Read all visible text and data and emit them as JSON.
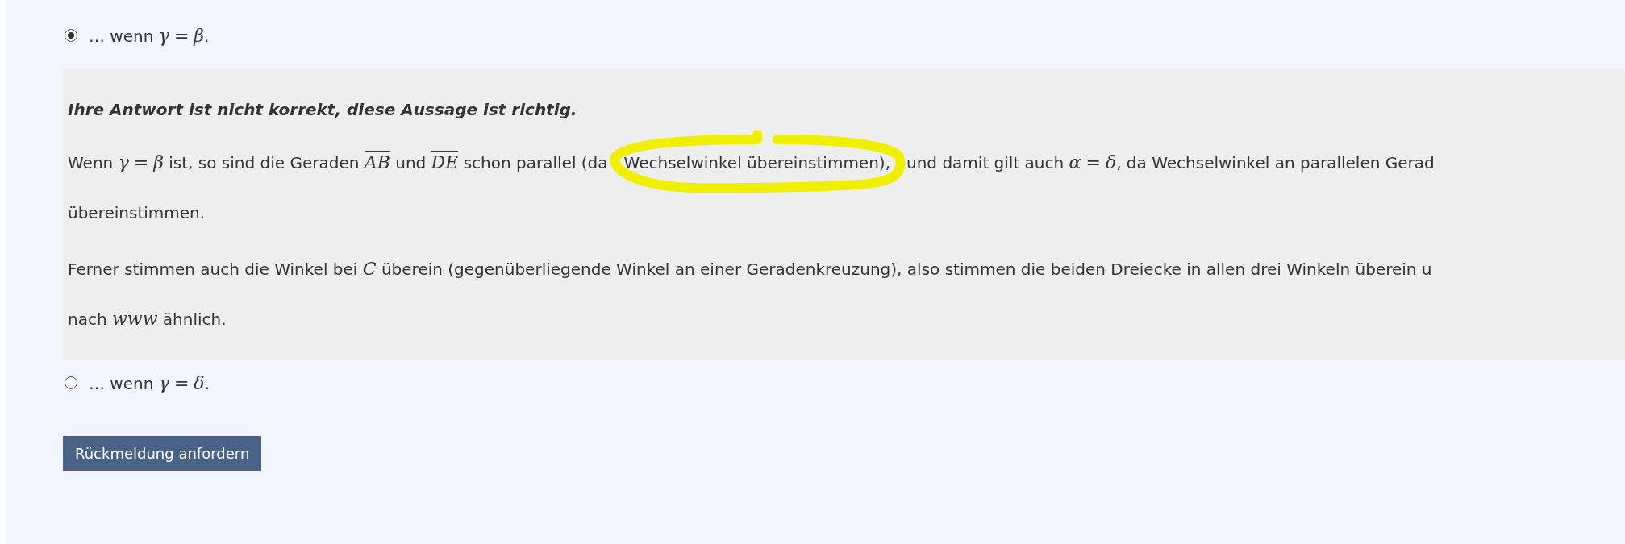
{
  "options": [
    {
      "selected": true,
      "label": [
        {
          "kind": "text",
          "text": "… wenn "
        },
        {
          "kind": "math",
          "text": "γ"
        },
        {
          "kind": "op",
          "text": "="
        },
        {
          "kind": "math",
          "text": "β"
        },
        {
          "kind": "text",
          "text": "."
        }
      ],
      "feedback": {
        "verdict": "Ihre Antwort ist nicht korrekt, diese Aussage ist richtig.",
        "paragraphs": [
          [
            [
              {
                "kind": "text",
                "text": "Wenn "
              },
              {
                "kind": "math",
                "text": "γ"
              },
              {
                "kind": "op",
                "text": "="
              },
              {
                "kind": "math",
                "text": "β"
              },
              {
                "kind": "text",
                "text": " ist, so sind die Geraden "
              },
              {
                "kind": "segment",
                "text": "AB"
              },
              {
                "kind": "text",
                "text": " und "
              },
              {
                "kind": "segment",
                "text": "DE"
              },
              {
                "kind": "text",
                "text": " schon parallel (da"
              },
              {
                "kind": "text",
                "text": "Wechselwinkel übereinstimmen),",
                "circled": true
              },
              {
                "kind": "text",
                "text": "und damit gilt auch "
              },
              {
                "kind": "math",
                "text": "α"
              },
              {
                "kind": "op",
                "text": "="
              },
              {
                "kind": "math",
                "text": "δ"
              },
              {
                "kind": "text",
                "text": ", da Wechselwinkel an parallelen Gerad"
              }
            ],
            [
              {
                "kind": "text",
                "text": "übereinstimmen."
              }
            ]
          ],
          [
            [
              {
                "kind": "text",
                "text": "Ferner stimmen auch die Winkel bei "
              },
              {
                "kind": "math",
                "text": "C"
              },
              {
                "kind": "text",
                "text": " überein (gegenüberliegende Winkel an einer Geradenkreuzung), also stimmen die beiden Dreiecke in allen drei Winkeln überein u"
              }
            ],
            [
              {
                "kind": "text",
                "text": "nach "
              },
              {
                "kind": "math",
                "text": "www"
              },
              {
                "kind": "text",
                "text": " ähnlich."
              }
            ]
          ]
        ]
      }
    },
    {
      "selected": false,
      "label": [
        {
          "kind": "text",
          "text": "… wenn "
        },
        {
          "kind": "math",
          "text": "γ"
        },
        {
          "kind": "op",
          "text": "="
        },
        {
          "kind": "math",
          "text": "δ"
        },
        {
          "kind": "text",
          "text": "."
        }
      ]
    }
  ],
  "highlight": {
    "kind": "circle",
    "color": "#f0ef00"
  },
  "button": {
    "label": "Rückmeldung anfordern"
  }
}
